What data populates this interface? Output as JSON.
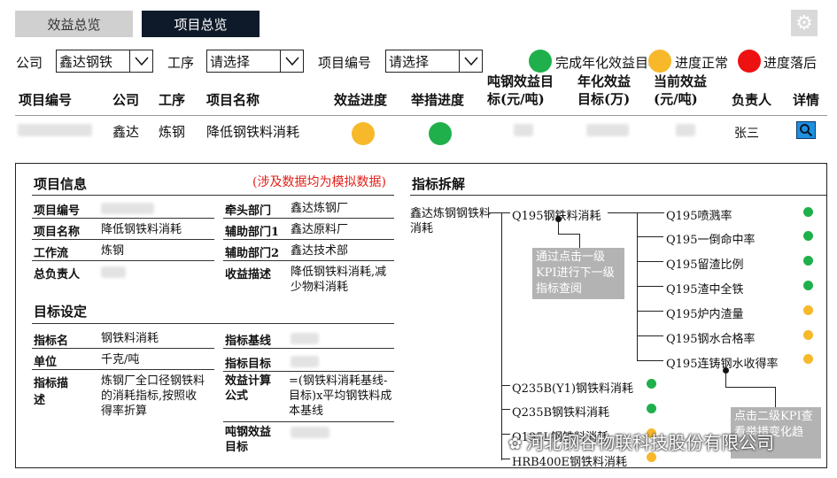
{
  "tabs": [
    {
      "label": "效益总览"
    },
    {
      "label": "项目总览"
    }
  ],
  "filters": {
    "company_label": "公司",
    "company_value": "鑫达钢铁",
    "process_label": "工序",
    "process_value": "请选择",
    "project_no_label": "项目编号",
    "project_no_value": "请选择"
  },
  "legend": [
    {
      "label": "完成年化效益目标",
      "color": "#1fb04b"
    },
    {
      "label": "进度正常",
      "color": "#f7b82a"
    },
    {
      "label": "进度落后",
      "color": "#ee1111"
    }
  ],
  "table": {
    "headers": [
      "项目编号",
      "公司",
      "工序",
      "项目名称",
      "效益进度",
      "举措进度",
      "吨钢效益目标(元/吨)",
      "年化效益目标(万)",
      "当前效益(元/吨)",
      "负责人",
      "详情"
    ],
    "row": {
      "company": "鑫达",
      "process": "炼钢",
      "project_name": "降低钢铁料消耗",
      "benefit_status_color": "#f7b82a",
      "measure_status_color": "#1fb04b",
      "owner": "张三"
    }
  },
  "project_info": {
    "title": "项目信息",
    "note": "(涉及数据均为模拟数据)",
    "left": [
      {
        "key": "项目编号",
        "value": ""
      },
      {
        "key": "项目名称",
        "value": "降低钢铁料消耗"
      },
      {
        "key": "工作流",
        "value": "炼钢"
      },
      {
        "key": "总负责人",
        "value": ""
      }
    ],
    "right": [
      {
        "key": "牵头部门",
        "value": "鑫达炼钢厂"
      },
      {
        "key": "辅助部门1",
        "value": "鑫达原料厂"
      },
      {
        "key": "辅助部门2",
        "value": "鑫达技术部"
      },
      {
        "key": "收益描述",
        "value": "降低钢铁料消耗,减少物料消耗"
      }
    ]
  },
  "target": {
    "title": "目标设定",
    "left": [
      {
        "key": "指标名",
        "value": "钢铁料消耗"
      },
      {
        "key": "单位",
        "value": "千克/吨"
      },
      {
        "key": "指标描述",
        "value": "炼钢厂全口径钢铁料的消耗指标,按照收得率折算"
      }
    ],
    "right": [
      {
        "key": "指标基线",
        "value": ""
      },
      {
        "key": "指标目标",
        "value": ""
      },
      {
        "key": "效益计算公式",
        "value": "=(钢铁料消耗基线-目标)x平均钢铁料成本基线"
      },
      {
        "key": "吨钢效益目标",
        "value": ""
      }
    ]
  },
  "kpi": {
    "title": "指标拆解",
    "root": "鑫达炼钢钢铁料消耗",
    "level1": [
      {
        "label": "Q195钢铁料消耗"
      },
      {
        "label": "Q235B(Y1)钢铁料消耗",
        "color": "#1fb04b"
      },
      {
        "label": "Q235B钢铁料消耗",
        "color": "#1fb04b"
      },
      {
        "label": "Q195L钢铁料消耗",
        "color": "#f7b82a"
      },
      {
        "label": "HRB400E钢铁料消耗",
        "color": "#f7b82a"
      }
    ],
    "level2": [
      {
        "label": "Q195喷溅率",
        "color": "#1fb04b"
      },
      {
        "label": "Q195一倒命中率",
        "color": "#1fb04b"
      },
      {
        "label": "Q195留渣比例",
        "color": "#1fb04b"
      },
      {
        "label": "Q195渣中全铁",
        "color": "#1fb04b"
      },
      {
        "label": "Q195炉内渣量",
        "color": "#f7b82a"
      },
      {
        "label": "Q195钢水合格率",
        "color": "#f7b82a"
      },
      {
        "label": "Q195连铸钢水收得率",
        "color": "#f7b82a"
      }
    ],
    "callout1": "通过点击一级KPI进行下一级指标查阅",
    "callout2": "点击二级KPI查看举措变化趋"
  },
  "watermark": "河北钢谷物联科技股份有限公司"
}
